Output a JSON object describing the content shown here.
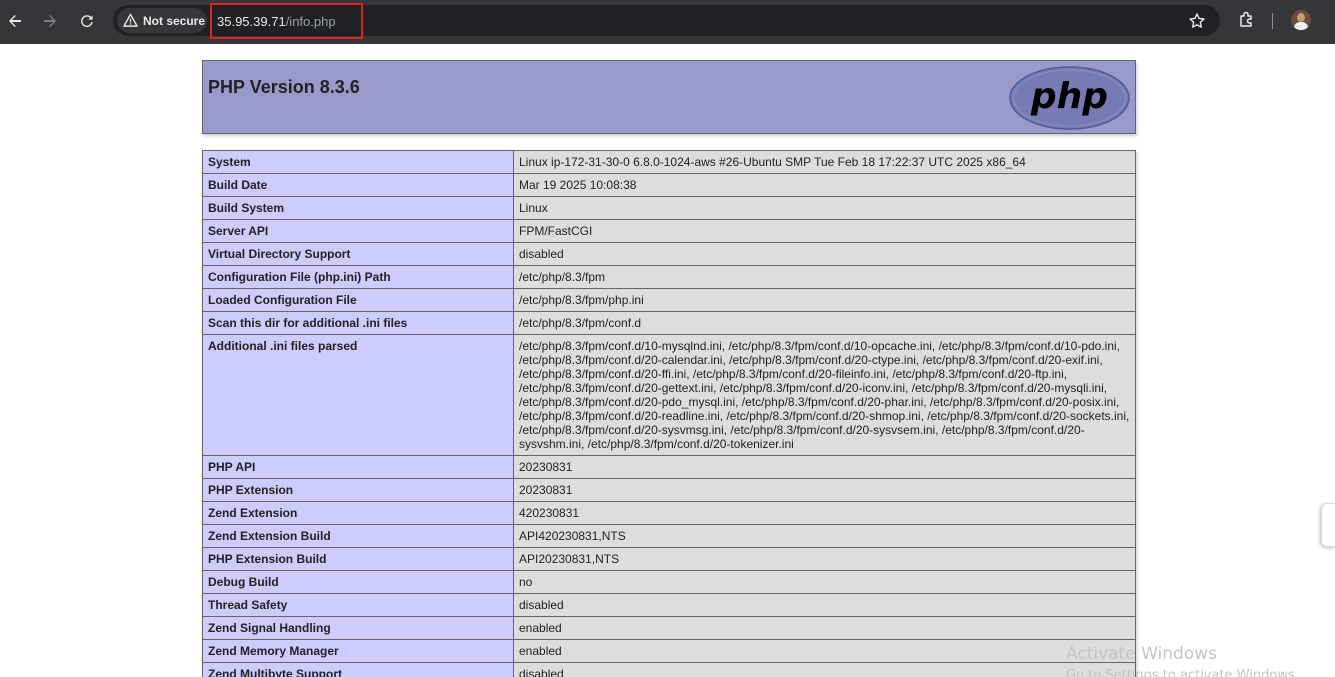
{
  "browser": {
    "security_label": "Not secure",
    "url_host": "35.95.39.71",
    "url_path": "/info.php",
    "icons": {
      "back": "back-arrow-icon",
      "forward": "forward-arrow-icon",
      "reload": "reload-icon",
      "warning": "warning-triangle-icon",
      "bookmark": "star-icon",
      "extensions": "puzzle-icon",
      "profile": "avatar"
    }
  },
  "phpinfo": {
    "title": "PHP Version 8.3.6",
    "logo_text": "php",
    "rows": [
      {
        "label": "System",
        "value": "Linux ip-172-31-30-0 6.8.0-1024-aws #26-Ubuntu SMP Tue Feb 18 17:22:37 UTC 2025 x86_64"
      },
      {
        "label": "Build Date",
        "value": "Mar 19 2025 10:08:38"
      },
      {
        "label": "Build System",
        "value": "Linux"
      },
      {
        "label": "Server API",
        "value": "FPM/FastCGI"
      },
      {
        "label": "Virtual Directory Support",
        "value": "disabled"
      },
      {
        "label": "Configuration File (php.ini) Path",
        "value": "/etc/php/8.3/fpm"
      },
      {
        "label": "Loaded Configuration File",
        "value": "/etc/php/8.3/fpm/php.ini"
      },
      {
        "label": "Scan this dir for additional .ini files",
        "value": "/etc/php/8.3/fpm/conf.d"
      },
      {
        "label": "Additional .ini files parsed",
        "value": "/etc/php/8.3/fpm/conf.d/10-mysqlnd.ini, /etc/php/8.3/fpm/conf.d/10-opcache.ini, /etc/php/8.3/fpm/conf.d/10-pdo.ini, /etc/php/8.3/fpm/conf.d/20-calendar.ini, /etc/php/8.3/fpm/conf.d/20-ctype.ini, /etc/php/8.3/fpm/conf.d/20-exif.ini, /etc/php/8.3/fpm/conf.d/20-ffi.ini, /etc/php/8.3/fpm/conf.d/20-fileinfo.ini, /etc/php/8.3/fpm/conf.d/20-ftp.ini, /etc/php/8.3/fpm/conf.d/20-gettext.ini, /etc/php/8.3/fpm/conf.d/20-iconv.ini, /etc/php/8.3/fpm/conf.d/20-mysqli.ini, /etc/php/8.3/fpm/conf.d/20-pdo_mysql.ini, /etc/php/8.3/fpm/conf.d/20-phar.ini, /etc/php/8.3/fpm/conf.d/20-posix.ini, /etc/php/8.3/fpm/conf.d/20-readline.ini, /etc/php/8.3/fpm/conf.d/20-shmop.ini, /etc/php/8.3/fpm/conf.d/20-sockets.ini, /etc/php/8.3/fpm/conf.d/20-sysvmsg.ini, /etc/php/8.3/fpm/conf.d/20-sysvsem.ini, /etc/php/8.3/fpm/conf.d/20-sysvshm.ini, /etc/php/8.3/fpm/conf.d/20-tokenizer.ini"
      },
      {
        "label": "PHP API",
        "value": "20230831"
      },
      {
        "label": "PHP Extension",
        "value": "20230831"
      },
      {
        "label": "Zend Extension",
        "value": "420230831"
      },
      {
        "label": "Zend Extension Build",
        "value": "API420230831,NTS"
      },
      {
        "label": "PHP Extension Build",
        "value": "API20230831,NTS"
      },
      {
        "label": "Debug Build",
        "value": "no"
      },
      {
        "label": "Thread Safety",
        "value": "disabled"
      },
      {
        "label": "Zend Signal Handling",
        "value": "enabled"
      },
      {
        "label": "Zend Memory Manager",
        "value": "enabled"
      },
      {
        "label": "Zend Multibyte Support",
        "value": "disabled"
      }
    ]
  },
  "watermark": {
    "title": "Activate Windows",
    "subtitle": "Go to Settings to activate Windows."
  },
  "colors": {
    "header_bg": "#9999cc",
    "label_cell_bg": "#ccccff",
    "value_cell_bg": "#dddddd",
    "url_highlight": "#d9242a"
  }
}
